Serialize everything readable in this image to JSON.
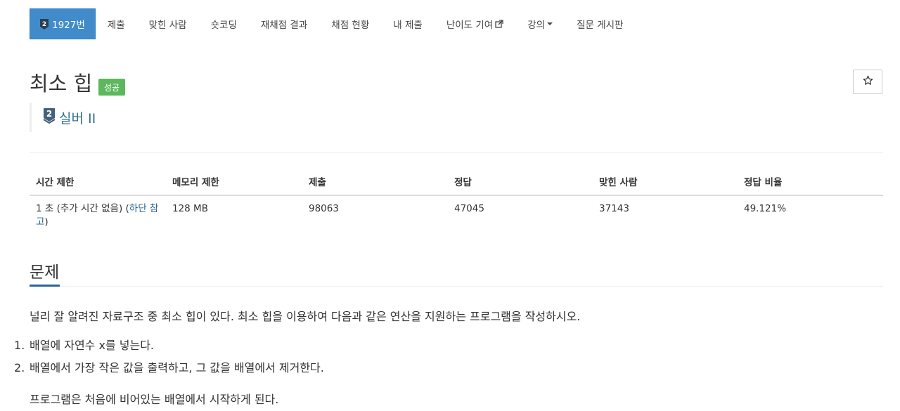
{
  "nav": {
    "items": [
      {
        "label": "1927번",
        "active": true
      },
      {
        "label": "제출"
      },
      {
        "label": "맞힌 사람"
      },
      {
        "label": "숏코딩"
      },
      {
        "label": "재채점 결과"
      },
      {
        "label": "채점 현황"
      },
      {
        "label": "내 제출"
      },
      {
        "label": "난이도 기여"
      },
      {
        "label": "강의"
      },
      {
        "label": "질문 게시판"
      }
    ]
  },
  "problem": {
    "title": "최소 힙",
    "result_badge": "성공",
    "tier": "실버 II",
    "tier_number": "2"
  },
  "stats": {
    "headers": [
      "시간 제한",
      "메모리 제한",
      "제출",
      "정답",
      "맞힌 사람",
      "정답 비율"
    ],
    "time_limit_prefix": "1 초 (추가 시간 없음) (",
    "time_limit_link": "하단 참고",
    "time_limit_suffix": ")",
    "memory_limit": "128 MB",
    "submissions": "98063",
    "accepted": "47045",
    "solved_users": "37143",
    "ratio": "49.121%"
  },
  "section": {
    "title": "문제",
    "intro": "널리 잘 알려진 자료구조 중 최소 힙이 있다. 최소 힙을 이용하여 다음과 같은 연산을 지원하는 프로그램을 작성하시오.",
    "items": [
      {
        "num": "1.",
        "text": "배열에 자연수 x를 넣는다."
      },
      {
        "num": "2.",
        "text": "배열에서 가장 작은 값을 출력하고, 그 값을 배열에서 제거한다."
      }
    ],
    "outro": "프로그램은 처음에 비어있는 배열에서 시작하게 된다."
  },
  "colors": {
    "nav_active": "#428bca",
    "success_badge": "#5cb85c",
    "link": "#2a6496",
    "tier_silver": "#435f7a"
  },
  "icons": [
    "silver-tier-icon",
    "external-link-icon",
    "caret-down-icon",
    "star-icon"
  ]
}
